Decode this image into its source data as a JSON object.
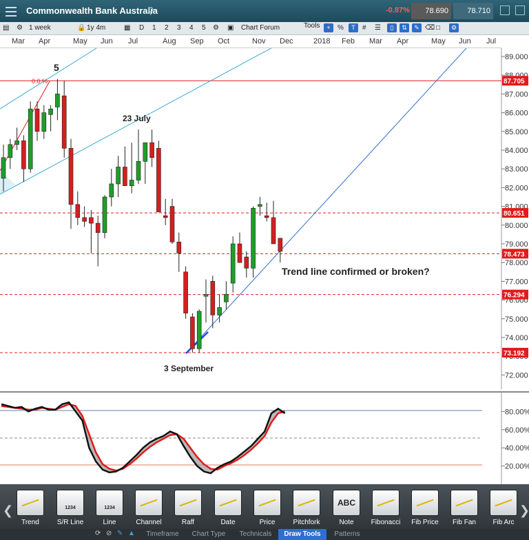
{
  "titlebar": {
    "instrument": "Commonwealth Bank Australia",
    "change": "-0.87%",
    "sell_price": "78.690",
    "buy_price": "78.710"
  },
  "toolbar": {
    "period": "1 week",
    "range": "1y 4m",
    "range_buttons": [
      "D",
      "1",
      "2",
      "3",
      "4",
      "5"
    ],
    "chart_forum": "Chart Forum",
    "tools_label": "Tools"
  },
  "time_axis": [
    "Mar",
    "Apr",
    "May",
    "Jun",
    "Jul",
    "Aug",
    "Sep",
    "Oct",
    "Nov",
    "Dec",
    "2018",
    "Feb",
    "Mar",
    "Apr",
    "May",
    "Jun",
    "Jul"
  ],
  "price_axis": [
    "89.000",
    "88.000",
    "87.000",
    "86.000",
    "85.000",
    "84.000",
    "83.000",
    "82.000",
    "81.000",
    "80.000",
    "79.000",
    "78.000",
    "77.000",
    "76.000",
    "75.000",
    "74.000",
    "73.000",
    "72.000"
  ],
  "price_levels": [
    {
      "label": "87.705",
      "color": "#e11b1b"
    },
    {
      "label": "80.651",
      "color": "#e11b1b"
    },
    {
      "label": "78.473",
      "color": "#e11b1b"
    },
    {
      "label": "76.294",
      "color": "#e11b1b"
    },
    {
      "label": "73.192",
      "color": "#e11b1b"
    }
  ],
  "annotations": {
    "wave5": "5",
    "fib0": "0.0 %",
    "july": "23 July",
    "sept": "3 September",
    "question": "Trend line confirmed or broken?"
  },
  "indicator_axis": [
    "80.00%",
    "60.00%",
    "40.00%",
    "20.00%"
  ],
  "draw_tools": [
    "Trend",
    "S/R Line",
    "Line",
    "Channel",
    "Raff",
    "Date",
    "Price",
    "Pitchfork",
    "Note",
    "Fibonacci",
    "Fib Price",
    "Fib Fan",
    "Fib Arc"
  ],
  "draw_tool_badges": {
    "sr": "1234",
    "line": "1234",
    "note": "ABC"
  },
  "tabs": [
    "Timeframe",
    "Chart Type",
    "Technicals",
    "Draw Tools",
    "Patterns"
  ],
  "active_tab": "Draw Tools",
  "chart_data": {
    "type": "candlestick",
    "ylim": [
      71.5,
      89.5
    ],
    "candles": [
      {
        "o": 82.5,
        "h": 84.3,
        "l": 81.8,
        "c": 83.6
      },
      {
        "o": 83.6,
        "h": 84.6,
        "l": 83.0,
        "c": 84.3
      },
      {
        "o": 84.3,
        "h": 85.2,
        "l": 84.0,
        "c": 84.5
      },
      {
        "o": 84.5,
        "h": 84.8,
        "l": 82.3,
        "c": 83.0
      },
      {
        "o": 83.0,
        "h": 86.6,
        "l": 82.8,
        "c": 86.2
      },
      {
        "o": 86.2,
        "h": 86.6,
        "l": 84.5,
        "c": 85.0
      },
      {
        "o": 85.0,
        "h": 86.4,
        "l": 84.6,
        "c": 86.0
      },
      {
        "o": 85.9,
        "h": 86.4,
        "l": 85.0,
        "c": 86.2
      },
      {
        "o": 86.3,
        "h": 87.8,
        "l": 85.6,
        "c": 87.0
      },
      {
        "o": 86.9,
        "h": 87.7,
        "l": 83.6,
        "c": 84.1
      },
      {
        "o": 84.1,
        "h": 84.6,
        "l": 79.8,
        "c": 81.1
      },
      {
        "o": 81.1,
        "h": 81.8,
        "l": 80.0,
        "c": 80.4
      },
      {
        "o": 80.4,
        "h": 81.0,
        "l": 79.9,
        "c": 80.2
      },
      {
        "o": 80.4,
        "h": 80.8,
        "l": 78.5,
        "c": 80.1
      },
      {
        "o": 80.1,
        "h": 80.5,
        "l": 77.8,
        "c": 79.6
      },
      {
        "o": 79.6,
        "h": 81.6,
        "l": 79.3,
        "c": 81.5
      },
      {
        "o": 81.5,
        "h": 83.0,
        "l": 81.0,
        "c": 82.2
      },
      {
        "o": 82.2,
        "h": 83.7,
        "l": 81.5,
        "c": 83.1
      },
      {
        "o": 83.1,
        "h": 84.2,
        "l": 82.1,
        "c": 82.1
      },
      {
        "o": 82.1,
        "h": 84.4,
        "l": 81.7,
        "c": 82.4
      },
      {
        "o": 82.4,
        "h": 85.1,
        "l": 82.2,
        "c": 83.4
      },
      {
        "o": 83.4,
        "h": 84.4,
        "l": 82.2,
        "c": 84.4
      },
      {
        "o": 84.4,
        "h": 85.1,
        "l": 83.1,
        "c": 83.6
      },
      {
        "o": 84.1,
        "h": 84.5,
        "l": 80.7,
        "c": 80.7
      },
      {
        "o": 80.5,
        "h": 81.4,
        "l": 80.0,
        "c": 80.4
      },
      {
        "o": 81.0,
        "h": 81.4,
        "l": 79.0,
        "c": 79.1
      },
      {
        "o": 79.1,
        "h": 79.6,
        "l": 77.5,
        "c": 78.5
      },
      {
        "o": 77.5,
        "h": 77.8,
        "l": 75.0,
        "c": 75.3
      },
      {
        "o": 75.1,
        "h": 75.3,
        "l": 73.2,
        "c": 73.4
      },
      {
        "o": 73.4,
        "h": 75.5,
        "l": 73.2,
        "c": 75.4
      },
      {
        "o": 76.2,
        "h": 77.1,
        "l": 74.8,
        "c": 76.3
      },
      {
        "o": 77.0,
        "h": 77.3,
        "l": 74.5,
        "c": 75.2
      },
      {
        "o": 75.2,
        "h": 76.3,
        "l": 74.8,
        "c": 75.6
      },
      {
        "o": 75.9,
        "h": 77.0,
        "l": 75.5,
        "c": 76.3
      },
      {
        "o": 76.9,
        "h": 79.4,
        "l": 76.4,
        "c": 79.0
      },
      {
        "o": 79.0,
        "h": 79.6,
        "l": 78.1,
        "c": 78.0
      },
      {
        "o": 78.3,
        "h": 78.6,
        "l": 77.2,
        "c": 77.7
      },
      {
        "o": 77.7,
        "h": 81.0,
        "l": 77.2,
        "c": 80.9
      },
      {
        "o": 81.0,
        "h": 81.5,
        "l": 80.5,
        "c": 81.1
      },
      {
        "o": 80.5,
        "h": 81.2,
        "l": 80.2,
        "c": 80.4
      },
      {
        "o": 80.4,
        "h": 81.3,
        "l": 79.0,
        "c": 79.0
      },
      {
        "o": 79.3,
        "h": 79.3,
        "l": 78.0,
        "c": 78.6
      }
    ],
    "stoch_k": [
      88,
      86,
      84,
      85,
      80,
      83,
      85,
      82,
      82,
      88,
      90,
      80,
      70,
      40,
      25,
      16,
      13,
      14,
      18,
      25,
      32,
      40,
      46,
      50,
      53,
      58,
      55,
      42,
      30,
      20,
      14,
      12,
      18,
      22,
      25,
      30,
      36,
      42,
      50,
      58,
      78,
      83,
      78
    ],
    "stoch_d": [
      86,
      85,
      84,
      83,
      82,
      82,
      84,
      83,
      82,
      85,
      88,
      86,
      75,
      55,
      35,
      22,
      17,
      15,
      17,
      22,
      28,
      35,
      41,
      46,
      50,
      54,
      55,
      50,
      40,
      30,
      22,
      17,
      16,
      20,
      23,
      27,
      32,
      38,
      45,
      53,
      68,
      78,
      80
    ]
  }
}
